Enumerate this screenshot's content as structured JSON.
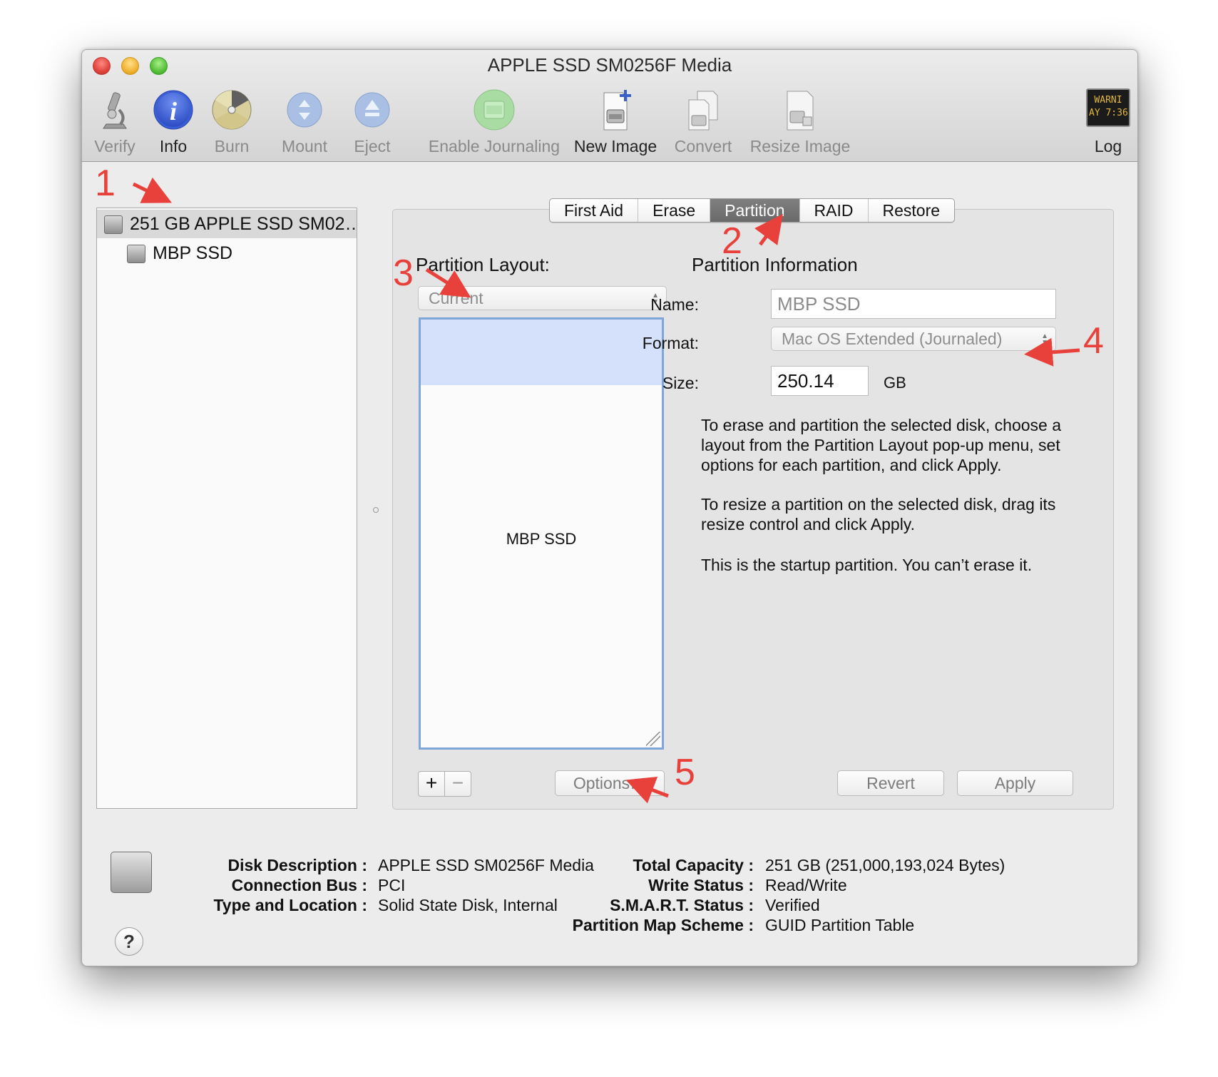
{
  "window": {
    "title": "APPLE SSD SM0256F Media"
  },
  "toolbar": {
    "verify": "Verify",
    "info": "Info",
    "burn": "Burn",
    "mount": "Mount",
    "eject": "Eject",
    "enable_journaling": "Enable Journaling",
    "new_image": "New Image",
    "convert": "Convert",
    "resize_image": "Resize Image",
    "log": "Log",
    "log_icon_text": "WARNI\nAY 7:36"
  },
  "sidebar": {
    "items": [
      {
        "label": "251 GB APPLE SSD SM02…",
        "selected": true
      },
      {
        "label": "MBP SSD",
        "selected": false
      }
    ]
  },
  "tabs": [
    "First Aid",
    "Erase",
    "Partition",
    "RAID",
    "Restore"
  ],
  "active_tab": "Partition",
  "partition": {
    "layout_label": "Partition Layout:",
    "layout_value": "Current",
    "layout_partition_name": "MBP SSD",
    "info_label": "Partition Information",
    "name_label": "Name:",
    "name_value": "MBP SSD",
    "format_label": "Format:",
    "format_value": "Mac OS Extended (Journaled)",
    "size_label": "Size:",
    "size_value": "250.14",
    "size_unit": "GB",
    "help_text_1": "To erase and partition the selected disk, choose a layout from the Partition Layout pop-up menu, set options for each partition, and click Apply.",
    "help_text_2": "To resize a partition on the selected disk, drag its resize control and click Apply.",
    "help_text_3": "This is the startup partition. You can’t erase it.",
    "add": "+",
    "remove": "−",
    "options": "Options…",
    "revert": "Revert",
    "apply": "Apply"
  },
  "disk_info": {
    "disk_description_key": "Disk Description :",
    "disk_description": "APPLE SSD SM0256F Media",
    "connection_bus_key": "Connection Bus :",
    "connection_bus": "PCI",
    "type_location_key": "Type and Location :",
    "type_location": "Solid State Disk, Internal",
    "total_capacity_key": "Total Capacity :",
    "total_capacity": "251 GB (251,000,193,024 Bytes)",
    "write_status_key": "Write Status :",
    "write_status": "Read/Write",
    "smart_status_key": "S.M.A.R.T. Status :",
    "smart_status": "Verified",
    "partition_map_key": "Partition Map Scheme :",
    "partition_map": "GUID Partition Table",
    "help": "?"
  },
  "annotations": [
    "1",
    "2",
    "3",
    "4",
    "5"
  ],
  "colors": {
    "annotation": "#e8403a",
    "selection": "#d5e0fb",
    "focus_ring": "#7ea6d9",
    "active_tab": "#727272"
  }
}
